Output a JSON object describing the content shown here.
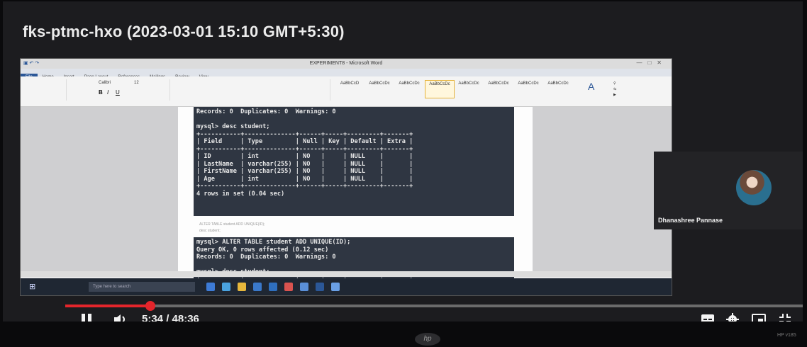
{
  "meeting": {
    "title": "fks-ptmc-hxo (2023-03-01 15:10 GMT+5:30)"
  },
  "word": {
    "window_title": "EXPERIMENT8 - Microsoft Word",
    "tabs": [
      "File",
      "Home",
      "Insert",
      "Page Layout",
      "References",
      "Mailings",
      "Review",
      "View"
    ],
    "styles": [
      "AaBbCcD",
      "AaBbCcDc",
      "AaBbCcDc",
      "AaBbCcDc",
      "AaBbCcDc",
      "AaBbCcDc",
      "AaBbCcDc",
      "AaBbCcDc"
    ],
    "font_name": "Calibri",
    "font_size": "12",
    "terminal_1": "Records: 0  Duplicates: 0  Warnings: 0\n\nmysql> desc student;\n+-----------+--------------+------+-----+---------+-------+\n| Field     | Type         | Null | Key | Default | Extra |\n+-----------+--------------+------+-----+---------+-------+\n| ID        | int          | NO   |     | NULL    |       |\n| LastName  | varchar(255) | NO   |     | NULL    |       |\n| FirstName | varchar(255) | NO   |     | NULL    |       |\n| Age       | int          | NO   |     | NULL    |       |\n+-----------+--------------+------+-----+---------+-------+\n4 rows in set (0.04 sec)",
    "doc_line_1": "ALTER TABLE student ADD UNIQUE(ID);",
    "doc_line_2": "desc student;",
    "terminal_2": "mysql> ALTER TABLE student ADD UNIQUE(ID);\nQuery OK, 0 rows affected (0.12 sec)\nRecords: 0  Duplicates: 0  Warnings: 0\n\nmysql> desc student;\n+-----------+--------------+------+-----+---------+-------+\n| Field     | Type         | Null | Key | Default | Extra |",
    "taskbar_search": "Type here to search"
  },
  "participant": {
    "name": "Dhanashree Pannase"
  },
  "player": {
    "current_time": "5:34",
    "duration": "48:36",
    "time_display": "5:34 / 48:36",
    "progress_fraction": 0.115,
    "accent_color": "#e4252b"
  },
  "icons": [
    "pause-icon",
    "volume-icon",
    "subtitles-icon",
    "settings-icon",
    "miniplayer-icon",
    "fullscreen-icon"
  ],
  "device": {
    "brand_logo": "hp",
    "model_label": "HP v185"
  }
}
